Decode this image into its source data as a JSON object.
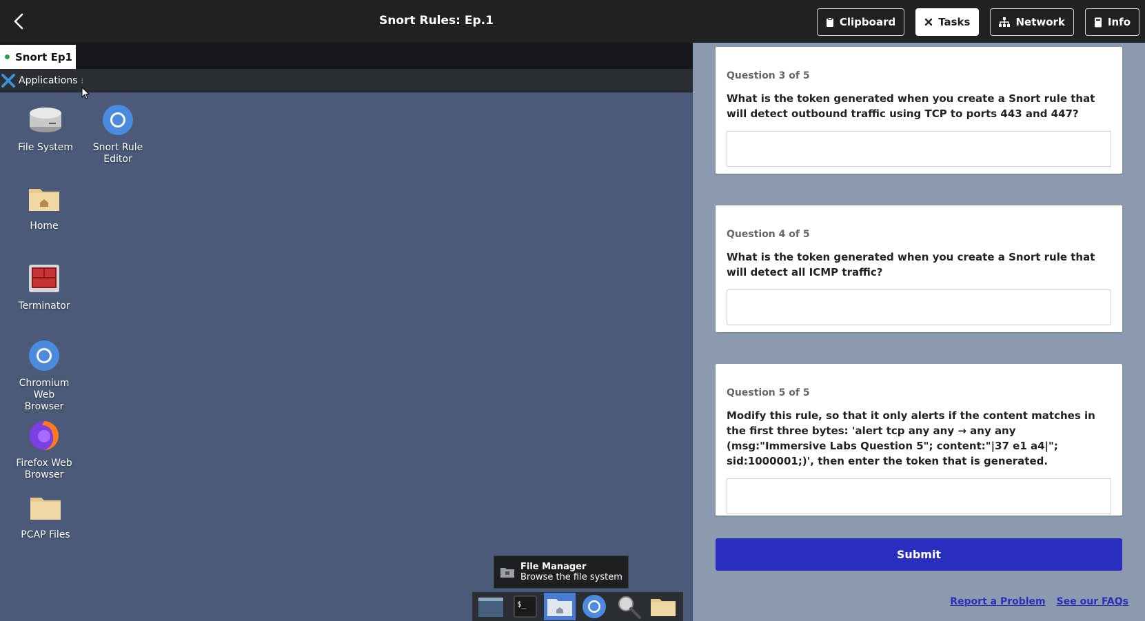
{
  "header": {
    "title": "Snort Rules: Ep.1",
    "buttons": {
      "clipboard": "Clipboard",
      "tasks": "Tasks",
      "network": "Network",
      "info": "Info"
    }
  },
  "desktop": {
    "session_tab": "Snort Ep1",
    "app_menu": "Applications",
    "icons": {
      "file_system": "File System",
      "snort_editor": "Snort Rule Editor",
      "home": "Home",
      "terminator": "Terminator",
      "chromium": "Chromium Web Browser",
      "firefox": "Firefox Web Browser",
      "pcap": "PCAP Files"
    },
    "tooltip": {
      "title": "File Manager",
      "subtitle": "Browse the file system"
    }
  },
  "questions": [
    {
      "number": "Question 3 of 5",
      "text": "What is the token generated when you create a Snort rule that will detect outbound traffic using TCP to ports 443 and 447?",
      "value": ""
    },
    {
      "number": "Question 4 of 5",
      "text": "What is the token generated when you create a Snort rule that will detect all ICMP traffic?",
      "value": ""
    },
    {
      "number": "Question 5 of 5",
      "text": "Modify this rule, so that it only alerts if the content matches in the first three bytes: 'alert tcp any any → any any (msg:\"Immersive Labs Question 5\"; content:\"|37 e1 a4|\"; sid:1000001;)', then enter the token that is generated.",
      "value": ""
    }
  ],
  "submit_label": "Submit",
  "footer": {
    "report": "Report a Problem",
    "faq": "See our FAQs"
  },
  "colors": {
    "header_bg": "#1f2220",
    "desktop_bg": "#4a5a78",
    "panel_bg": "#8c9ab0",
    "submit_bg": "#2a2ebf",
    "session_dot": "#2ea44f"
  }
}
